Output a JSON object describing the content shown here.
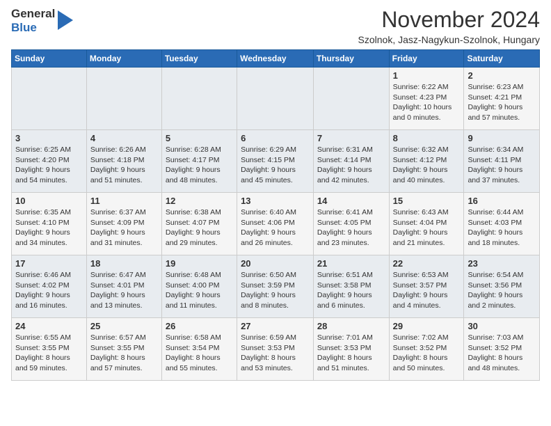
{
  "header": {
    "logo_line1": "General",
    "logo_line2": "Blue",
    "month_title": "November 2024",
    "location": "Szolnok, Jasz-Nagykun-Szolnok, Hungary"
  },
  "weekdays": [
    "Sunday",
    "Monday",
    "Tuesday",
    "Wednesday",
    "Thursday",
    "Friday",
    "Saturday"
  ],
  "weeks": [
    [
      {
        "day": "",
        "info": ""
      },
      {
        "day": "",
        "info": ""
      },
      {
        "day": "",
        "info": ""
      },
      {
        "day": "",
        "info": ""
      },
      {
        "day": "",
        "info": ""
      },
      {
        "day": "1",
        "info": "Sunrise: 6:22 AM\nSunset: 4:23 PM\nDaylight: 10 hours\nand 0 minutes."
      },
      {
        "day": "2",
        "info": "Sunrise: 6:23 AM\nSunset: 4:21 PM\nDaylight: 9 hours\nand 57 minutes."
      }
    ],
    [
      {
        "day": "3",
        "info": "Sunrise: 6:25 AM\nSunset: 4:20 PM\nDaylight: 9 hours\nand 54 minutes."
      },
      {
        "day": "4",
        "info": "Sunrise: 6:26 AM\nSunset: 4:18 PM\nDaylight: 9 hours\nand 51 minutes."
      },
      {
        "day": "5",
        "info": "Sunrise: 6:28 AM\nSunset: 4:17 PM\nDaylight: 9 hours\nand 48 minutes."
      },
      {
        "day": "6",
        "info": "Sunrise: 6:29 AM\nSunset: 4:15 PM\nDaylight: 9 hours\nand 45 minutes."
      },
      {
        "day": "7",
        "info": "Sunrise: 6:31 AM\nSunset: 4:14 PM\nDaylight: 9 hours\nand 42 minutes."
      },
      {
        "day": "8",
        "info": "Sunrise: 6:32 AM\nSunset: 4:12 PM\nDaylight: 9 hours\nand 40 minutes."
      },
      {
        "day": "9",
        "info": "Sunrise: 6:34 AM\nSunset: 4:11 PM\nDaylight: 9 hours\nand 37 minutes."
      }
    ],
    [
      {
        "day": "10",
        "info": "Sunrise: 6:35 AM\nSunset: 4:10 PM\nDaylight: 9 hours\nand 34 minutes."
      },
      {
        "day": "11",
        "info": "Sunrise: 6:37 AM\nSunset: 4:09 PM\nDaylight: 9 hours\nand 31 minutes."
      },
      {
        "day": "12",
        "info": "Sunrise: 6:38 AM\nSunset: 4:07 PM\nDaylight: 9 hours\nand 29 minutes."
      },
      {
        "day": "13",
        "info": "Sunrise: 6:40 AM\nSunset: 4:06 PM\nDaylight: 9 hours\nand 26 minutes."
      },
      {
        "day": "14",
        "info": "Sunrise: 6:41 AM\nSunset: 4:05 PM\nDaylight: 9 hours\nand 23 minutes."
      },
      {
        "day": "15",
        "info": "Sunrise: 6:43 AM\nSunset: 4:04 PM\nDaylight: 9 hours\nand 21 minutes."
      },
      {
        "day": "16",
        "info": "Sunrise: 6:44 AM\nSunset: 4:03 PM\nDaylight: 9 hours\nand 18 minutes."
      }
    ],
    [
      {
        "day": "17",
        "info": "Sunrise: 6:46 AM\nSunset: 4:02 PM\nDaylight: 9 hours\nand 16 minutes."
      },
      {
        "day": "18",
        "info": "Sunrise: 6:47 AM\nSunset: 4:01 PM\nDaylight: 9 hours\nand 13 minutes."
      },
      {
        "day": "19",
        "info": "Sunrise: 6:48 AM\nSunset: 4:00 PM\nDaylight: 9 hours\nand 11 minutes."
      },
      {
        "day": "20",
        "info": "Sunrise: 6:50 AM\nSunset: 3:59 PM\nDaylight: 9 hours\nand 8 minutes."
      },
      {
        "day": "21",
        "info": "Sunrise: 6:51 AM\nSunset: 3:58 PM\nDaylight: 9 hours\nand 6 minutes."
      },
      {
        "day": "22",
        "info": "Sunrise: 6:53 AM\nSunset: 3:57 PM\nDaylight: 9 hours\nand 4 minutes."
      },
      {
        "day": "23",
        "info": "Sunrise: 6:54 AM\nSunset: 3:56 PM\nDaylight: 9 hours\nand 2 minutes."
      }
    ],
    [
      {
        "day": "24",
        "info": "Sunrise: 6:55 AM\nSunset: 3:55 PM\nDaylight: 8 hours\nand 59 minutes."
      },
      {
        "day": "25",
        "info": "Sunrise: 6:57 AM\nSunset: 3:55 PM\nDaylight: 8 hours\nand 57 minutes."
      },
      {
        "day": "26",
        "info": "Sunrise: 6:58 AM\nSunset: 3:54 PM\nDaylight: 8 hours\nand 55 minutes."
      },
      {
        "day": "27",
        "info": "Sunrise: 6:59 AM\nSunset: 3:53 PM\nDaylight: 8 hours\nand 53 minutes."
      },
      {
        "day": "28",
        "info": "Sunrise: 7:01 AM\nSunset: 3:53 PM\nDaylight: 8 hours\nand 51 minutes."
      },
      {
        "day": "29",
        "info": "Sunrise: 7:02 AM\nSunset: 3:52 PM\nDaylight: 8 hours\nand 50 minutes."
      },
      {
        "day": "30",
        "info": "Sunrise: 7:03 AM\nSunset: 3:52 PM\nDaylight: 8 hours\nand 48 minutes."
      }
    ]
  ]
}
